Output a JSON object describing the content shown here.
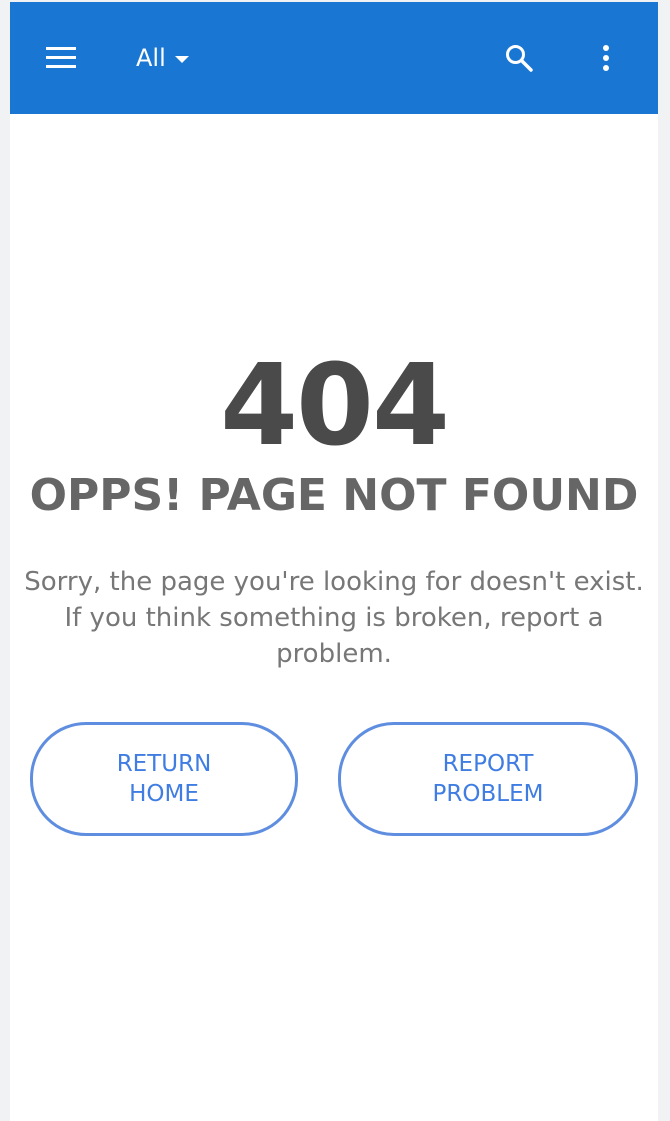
{
  "appbar": {
    "menu_icon": "hamburger-menu-icon",
    "filter_label": "All",
    "filter_icon": "caret-down-icon",
    "search_icon": "search-icon",
    "more_icon": "more-vert-icon",
    "color": "#1976d2"
  },
  "error": {
    "code": "404",
    "title": "OPPS! PAGE NOT FOUND",
    "message": "Sorry, the page you're looking for doesn't exist. If you think something is broken, report a problem."
  },
  "actions": {
    "return_home": [
      "RETURN",
      "HOME"
    ],
    "report_problem": [
      "REPORT",
      "PROBLEM"
    ],
    "accent_color": "#3f7de3"
  }
}
